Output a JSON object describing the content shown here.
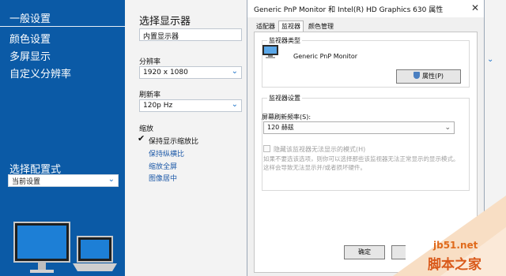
{
  "left_nav": {
    "items": [
      {
        "label": "一般设置",
        "active": true
      },
      {
        "label": "颜色设置"
      },
      {
        "label": "多屏显示"
      },
      {
        "label": "自定义分辨率"
      }
    ],
    "config_label": "选择配置式",
    "config_value": "当前设置"
  },
  "display_settings": {
    "title": "选择显示器",
    "display_value": "内置显示器",
    "resolution_label": "分辨率",
    "resolution_value": "1920 x 1080",
    "refresh_label": "刷新率",
    "refresh_value": "120p Hz",
    "scaling_label": "缩放",
    "scaling_options": [
      "保持显示缩放比",
      "保持纵横比",
      "缩放全屏",
      "图像居中"
    ]
  },
  "dialog": {
    "title": "Generic PnP Monitor 和 Intel(R) HD Graphics 630 属性",
    "close_glyph": "✕",
    "tabs": [
      "适配器",
      "监视器",
      "颜色管理"
    ],
    "active_tab": "监视器",
    "monitor_type_group": "监视器类型",
    "monitor_name": "Generic PnP Monitor",
    "properties_button": "属性(P)",
    "monitor_settings_group": "监视器设置",
    "refresh_rate_label": "屏幕刷新频率(S):",
    "refresh_rate_value": "120 赫兹",
    "hide_modes_label": "隐藏该监视器无法显示的模式(H)",
    "hide_modes_hint": "如果不要选该选项，则你可以选择那些该监视器无法正常显示的显示模式。这样会导致无法显示并/或者损坏硬件。",
    "ok_button": "确定"
  },
  "watermark": {
    "site": "jb51.net",
    "name": "脚本之家"
  },
  "colors": {
    "sidebar_blue": "#0b5aa6",
    "link_blue": "#1e5aa8",
    "watermark_orange": "#e06a1b"
  }
}
